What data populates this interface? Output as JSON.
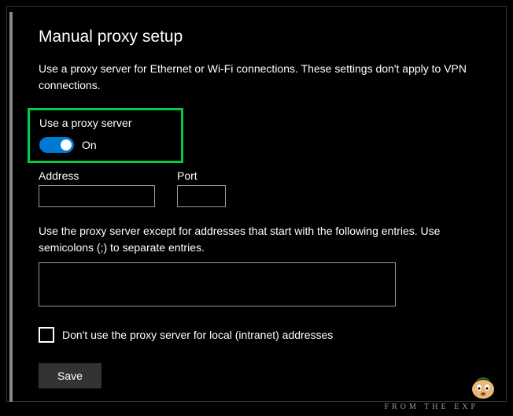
{
  "page": {
    "title": "Manual proxy setup",
    "description": "Use a proxy server for Ethernet or Wi-Fi connections. These settings don't apply to VPN connections."
  },
  "toggle": {
    "label": "Use a proxy server",
    "state": "On",
    "on": true
  },
  "fields": {
    "address_label": "Address",
    "address_value": "",
    "port_label": "Port",
    "port_value": ""
  },
  "exceptions": {
    "description": "Use the proxy server except for addresses that start with the following entries. Use semicolons (;) to separate entries.",
    "value": ""
  },
  "local_bypass": {
    "label": "Don't use the proxy server for local (intranet) addresses",
    "checked": false
  },
  "buttons": {
    "save": "Save"
  },
  "watermark": "FROM THE EXP"
}
